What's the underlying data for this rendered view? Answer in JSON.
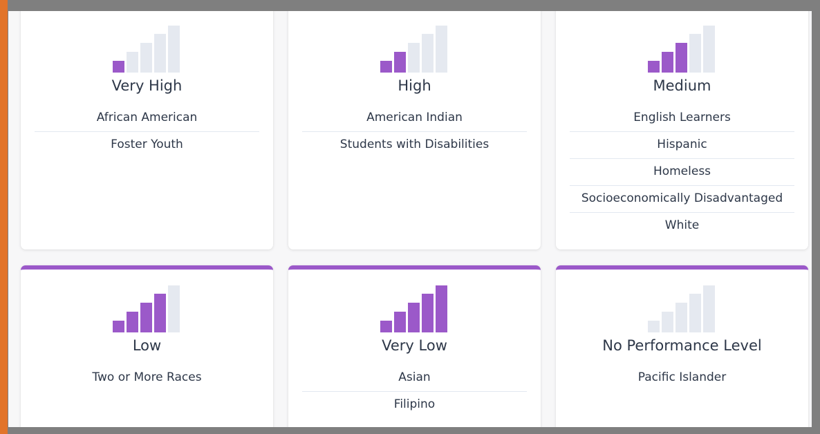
{
  "colors": {
    "accent": "#9b59c9",
    "bar_inactive": "#e5e9f0",
    "edge_strip": "#e2742a",
    "background": "#7f7f7f",
    "text": "#2d3748"
  },
  "cards": [
    {
      "title": "Very High",
      "icon": "signal-strength-icon",
      "filled_bars": 1,
      "groups": [
        "African American",
        "Foster Youth"
      ]
    },
    {
      "title": "High",
      "icon": "signal-strength-icon",
      "filled_bars": 2,
      "groups": [
        "American Indian",
        "Students with Disabilities"
      ]
    },
    {
      "title": "Medium",
      "icon": "signal-strength-icon",
      "filled_bars": 3,
      "groups": [
        "English Learners",
        "Hispanic",
        "Homeless",
        "Socioeconomically Disadvantaged",
        "White"
      ]
    },
    {
      "title": "Low",
      "icon": "signal-strength-icon",
      "filled_bars": 4,
      "groups": [
        "Two or More Races"
      ]
    },
    {
      "title": "Very Low",
      "icon": "signal-strength-icon",
      "filled_bars": 5,
      "groups": [
        "Asian",
        "Filipino"
      ]
    },
    {
      "title": "No Performance Level",
      "icon": "signal-strength-icon",
      "filled_bars": 0,
      "groups": [
        "Pacific Islander"
      ]
    }
  ]
}
